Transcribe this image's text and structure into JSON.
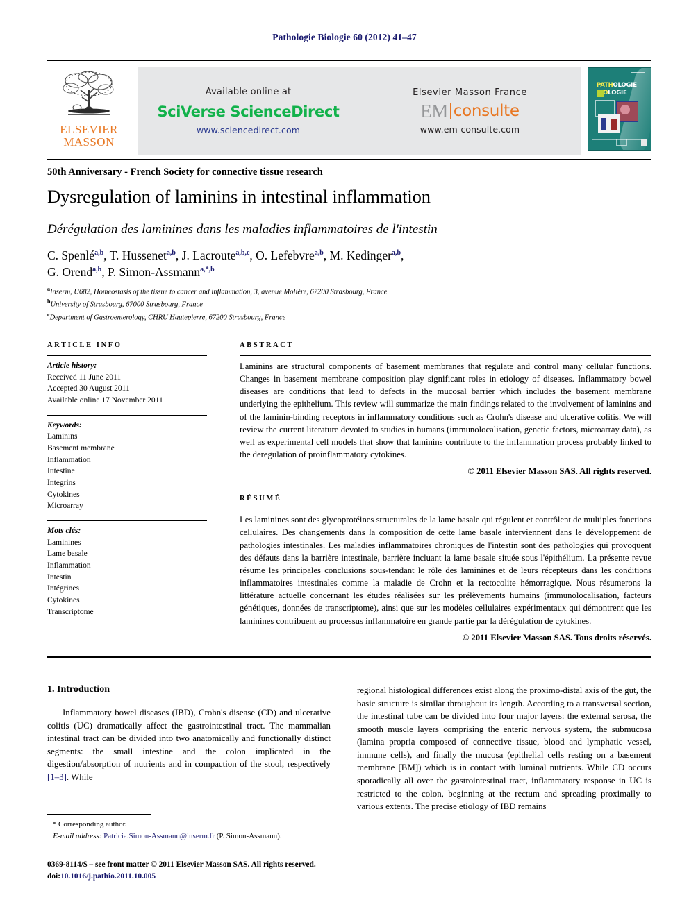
{
  "running_head": "Pathologie Biologie 60 (2012) 41–47",
  "masthead": {
    "elsevier_line1": "ELSEVIER",
    "elsevier_line2": "MASSON",
    "available_online": "Available online at",
    "sciencedirect_logo": "SciVerse ScienceDirect",
    "sciencedirect_url": "www.sciencedirect.com",
    "elsevier_masson_france": "Elsevier Masson France",
    "em_logo_left": "EM",
    "em_logo_right": "consulte",
    "em_url": "www.em-consulte.com",
    "cover_title_line1_a": "PATH",
    "cover_title_line1_b": "OLOGIE",
    "cover_title_line2_a": "BIO",
    "cover_title_line2_b": "LOGIE"
  },
  "article": {
    "section_label": "50th Anniversary - French Society for connective tissue research",
    "title_en": "Dysregulation of laminins in intestinal inflammation",
    "title_fr": "Dérégulation des laminines dans les maladies inflammatoires de l'intestin",
    "authors": [
      {
        "name": "C. Spenlé",
        "sup": "a,b",
        "sep": ", "
      },
      {
        "name": "T. Hussenet",
        "sup": "a,b",
        "sep": ", "
      },
      {
        "name": "J. Lacroute",
        "sup": "a,b,c",
        "sep": ", "
      },
      {
        "name": "O. Lefebvre",
        "sup": "a,b",
        "sep": ", "
      },
      {
        "name": "M. Kedinger",
        "sup": "a,b",
        "sep": ", "
      },
      {
        "name": "G. Orend",
        "sup": "a,b",
        "sep": ", "
      },
      {
        "name": "P. Simon-Assmann",
        "sup": "a,*,b",
        "sep": ""
      }
    ],
    "affiliations": [
      {
        "mark": "a",
        "text": "Inserm, U682, Homeostasis of the tissue to cancer and inflammation, 3, avenue Molière, 67200 Strasbourg, France"
      },
      {
        "mark": "b",
        "text": "University of Strasbourg, 67000 Strasbourg, France"
      },
      {
        "mark": "c",
        "text": "Department of Gastroenterology, CHRU Hautepierre, 67200 Strasbourg, France"
      }
    ]
  },
  "info": {
    "heading": "Article info",
    "history_label": "Article history:",
    "history": [
      "Received 11 June 2011",
      "Accepted 30 August 2011",
      "Available online 17 November 2011"
    ],
    "keywords_label": "Keywords:",
    "keywords": [
      "Laminins",
      "Basement membrane",
      "Inflammation",
      "Intestine",
      "Integrins",
      "Cytokines",
      "Microarray"
    ],
    "motscles_label": "Mots clés:",
    "motscles": [
      "Laminines",
      "Lame basale",
      "Inflammation",
      "Intestin",
      "Intégrines",
      "Cytokines",
      "Transcriptome"
    ]
  },
  "abstract": {
    "heading": "Abstract",
    "text": "Laminins are structural components of basement membranes that regulate and control many cellular functions. Changes in basement membrane composition play significant roles in etiology of diseases. Inflammatory bowel diseases are conditions that lead to defects in the mucosal barrier which includes the basement membrane underlying the epithelium. This review will summarize the main findings related to the involvement of laminins and of the laminin-binding receptors in inflammatory conditions such as Crohn's disease and ulcerative colitis. We will review the current literature devoted to studies in humans (immunolocalisation, genetic factors, microarray data), as well as experimental cell models that show that laminins contribute to the inflammation process probably linked to the deregulation of proinflammatory cytokines.",
    "copyright": "© 2011 Elsevier Masson SAS. All rights reserved."
  },
  "resume": {
    "heading": "Résumé",
    "text": "Les laminines sont des glycoprotéines structurales de la lame basale qui régulent et contrôlent de multiples fonctions cellulaires. Des changements dans la composition de cette lame basale interviennent dans le développement de pathologies intestinales. Les maladies inflammatoires chroniques de l'intestin sont des pathologies qui provoquent des défauts dans la barrière intestinale, barrière incluant la lame basale située sous l'épithélium. La présente revue résume les principales conclusions sous-tendant le rôle des laminines et de leurs récepteurs dans les conditions inflammatoires intestinales comme la maladie de Crohn et la rectocolite hémorragique. Nous résumerons la littérature actuelle concernant les études réalisées sur les prélèvements humains (immunolocalisation, facteurs génétiques, données de transcriptome), ainsi que sur les modèles cellulaires expérimentaux qui démontrent que les laminines contribuent au processus inflammatoire en grande partie par la dérégulation de cytokines.",
    "copyright": "© 2011 Elsevier Masson SAS. Tous droits réservés."
  },
  "body": {
    "section_number_title": "1. Introduction",
    "left_paragraph_pre": "Inflammatory bowel diseases (IBD), Crohn's disease (CD) and ulcerative colitis (UC) dramatically affect the gastrointestinal tract. The mammalian intestinal tract can be divided into two anatomically and functionally distinct segments: the small intestine and the colon implicated in the digestion/absorption of nutrients and in compaction of the stool, respectively ",
    "left_reference": "[1–3]",
    "left_paragraph_post": ". While",
    "right_paragraph": "regional histological differences exist along the proximo-distal axis of the gut, the basic structure is similar throughout its length. According to a transversal section, the intestinal tube can be divided into four major layers: the external serosa, the smooth muscle layers comprising the enteric nervous system, the submucosa (lamina propria composed of connective tissue, blood and lymphatic vessel, immune cells), and finally the mucosa (epithelial cells resting on a basement membrane [BM]) which is in contact with luminal nutrients. While CD occurs sporadically all over the gastrointestinal tract, inflammatory response in UC is restricted to the colon, beginning at the rectum and spreading proximally to various extents. The precise etiology of IBD remains"
  },
  "footer": {
    "corresponding_mark": "*",
    "corresponding_text": "Corresponding author.",
    "email_label": "E-mail address:",
    "email": "Patricia.Simon-Assmann@inserm.fr",
    "email_owner": "(P. Simon-Assmann).",
    "issn_line": "0369-8114/$ – see front matter © 2011 Elsevier Masson SAS. All rights reserved.",
    "doi_label": "doi:",
    "doi": "10.1016/j.pathio.2011.10.005"
  },
  "colors": {
    "running_head": "#1a1a6e",
    "sciencedirect_green": "#12b24b",
    "elsevier_orange": "#E87722",
    "link_blue": "#2b3a8f",
    "cover_teal": "#1d7f78",
    "banner_grey": "#e6e7e8"
  }
}
